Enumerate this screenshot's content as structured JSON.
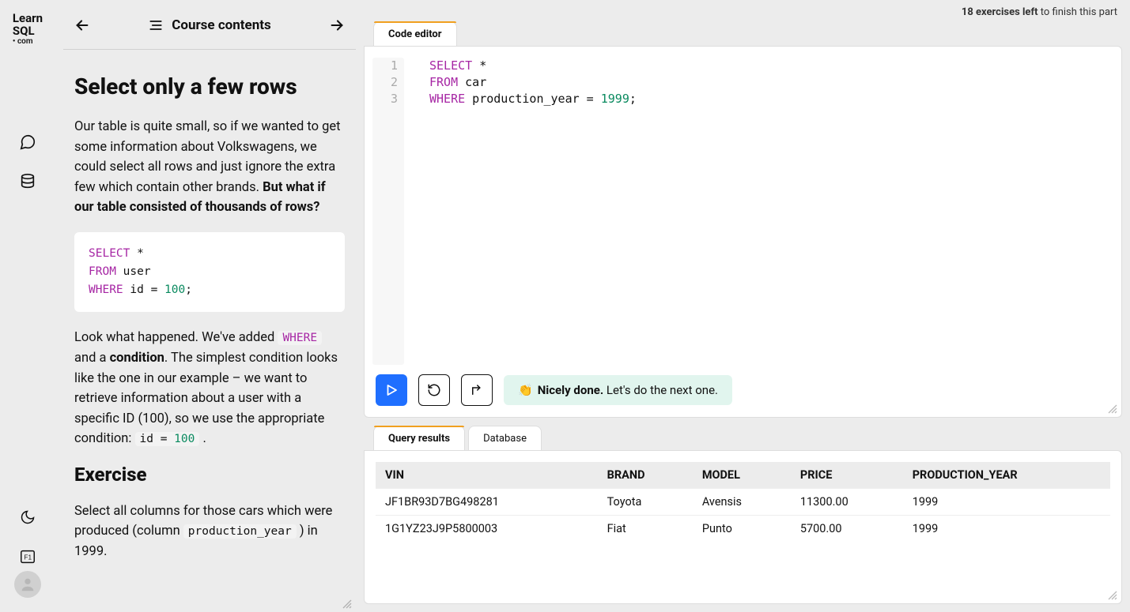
{
  "brand": {
    "line1": "Learn",
    "line2": "SQL",
    "line3": "• com"
  },
  "nav": {
    "title": "Course contents"
  },
  "progress": {
    "count": "18 exercises left",
    "suffix": " to finish this part"
  },
  "lesson": {
    "title": "Select only a few rows",
    "p1_a": "Our table is quite small, so if we wanted to get some information about Volkswagens, we could select all rows and just ignore the extra few which contain other brands. ",
    "p1_b": "But what if our table consisted of thousands of rows?",
    "example": {
      "l1_kw": "SELECT",
      "l1_rest": " *",
      "l2_kw": "FROM",
      "l2_rest": " user",
      "l3_kw": "WHERE",
      "l3_rest_a": " id = ",
      "l3_num": "100",
      "l3_rest_b": ";"
    },
    "p2_a": "Look what happened. We've added ",
    "p2_code1": "WHERE",
    "p2_b": " and a ",
    "p2_bold": "condition",
    "p2_c": ". The simplest condition looks like the one in our example – we want to retrieve information about a user with a specific ID (100), so we use the appropriate condition: ",
    "p2_code2_a": "id = ",
    "p2_code2_num": "100",
    "p2_d": " .",
    "exercise_heading": "Exercise",
    "ex_a": "Select all columns for those cars which were produced (column ",
    "ex_code": "production_year",
    "ex_b": " ) in 1999."
  },
  "editor": {
    "tab": "Code editor",
    "gutter": [
      "1",
      "2",
      "3"
    ],
    "code": {
      "l1_kw": "SELECT",
      "l1_rest": " *",
      "l2_kw": "FROM",
      "l2_rest": " car",
      "l3_kw": "WHERE",
      "l3_rest_a": " production_year = ",
      "l3_num": "1999",
      "l3_rest_b": ";"
    },
    "feedback_emoji": "👏",
    "feedback_bold": "Nicely done.",
    "feedback_rest": " Let's do the next one."
  },
  "results": {
    "tab_active": "Query results",
    "tab_other": "Database",
    "columns": [
      "VIN",
      "BRAND",
      "MODEL",
      "PRICE",
      "PRODUCTION_YEAR"
    ],
    "rows": [
      [
        "JF1BR93D7BG498281",
        "Toyota",
        "Avensis",
        "11300.00",
        "1999"
      ],
      [
        "1G1YZ23J9P5800003",
        "Fiat",
        "Punto",
        "5700.00",
        "1999"
      ]
    ]
  }
}
